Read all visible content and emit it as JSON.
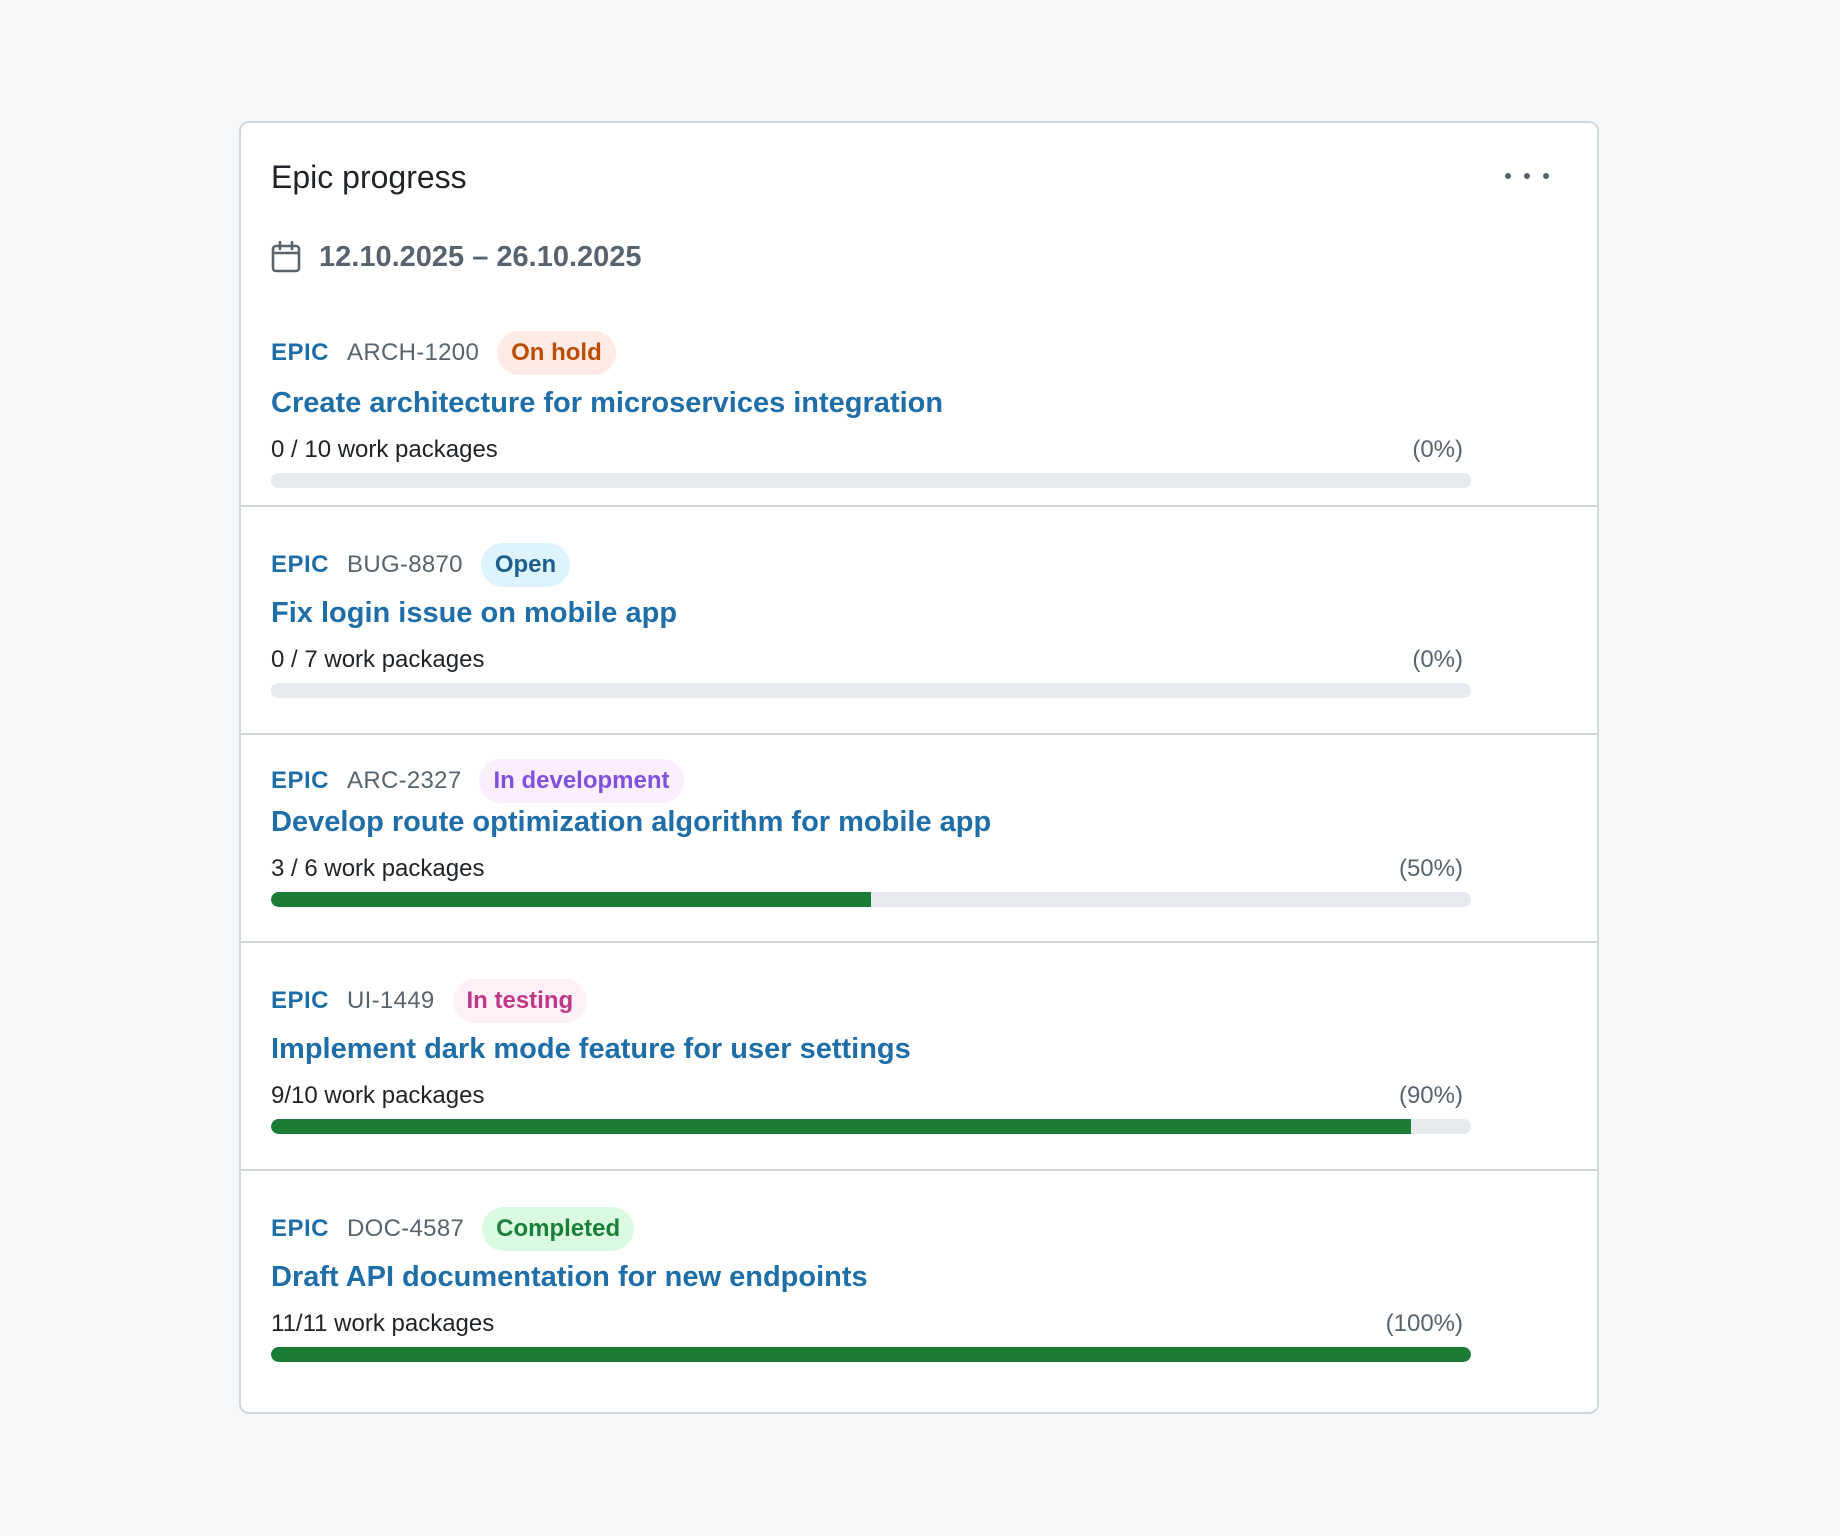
{
  "widget": {
    "title": "Epic progress",
    "menu_icon": "more-horizontal-icon",
    "date_icon": "calendar-icon",
    "date_range": "12.10.2025 – 26.10.2025"
  },
  "epics": [
    {
      "type": "EPIC",
      "id": "ARCH-1200",
      "status": "On hold",
      "status_bg": "#ffebe6",
      "status_color": "#bc4c00",
      "title": "Create architecture for microservices integration",
      "packages": "0 / 10 work packages",
      "percent": "(0%)",
      "progress": 0
    },
    {
      "type": "EPIC",
      "id": "BUG-8870",
      "status": "Open",
      "status_bg": "#ddf4ff",
      "status_color": "#1f5e8c",
      "title": "Fix login issue on mobile app",
      "packages": "0 / 7 work packages",
      "percent": "(0%)",
      "progress": 0
    },
    {
      "type": "EPIC",
      "id": "ARC-2327",
      "status": "In development",
      "status_bg": "#fbefff",
      "status_color": "#8250df",
      "title": "Develop route optimization algorithm for mobile app",
      "packages": "3 / 6 work packages",
      "percent": "(50%)",
      "progress": 0.5
    },
    {
      "type": "EPIC",
      "id": "UI-1449",
      "status": "In testing",
      "status_bg": "#ffeff7",
      "status_color": "#bf3989",
      "title": "Implement dark mode feature for user settings",
      "packages": "9/10 work packages",
      "percent": "(90%)",
      "progress": 0.95
    },
    {
      "type": "EPIC",
      "id": "DOC-4587",
      "status": "Completed",
      "status_bg": "#dafbe1",
      "status_color": "#1a7f37",
      "title": "Draft API documentation for new endpoints",
      "packages": "11/11 work packages",
      "percent": "(100%)",
      "progress": 1
    }
  ],
  "colors": {
    "accent": "#1f6ea8",
    "progress_fill": "#1b7c36",
    "progress_track": "#e6e9ed"
  }
}
